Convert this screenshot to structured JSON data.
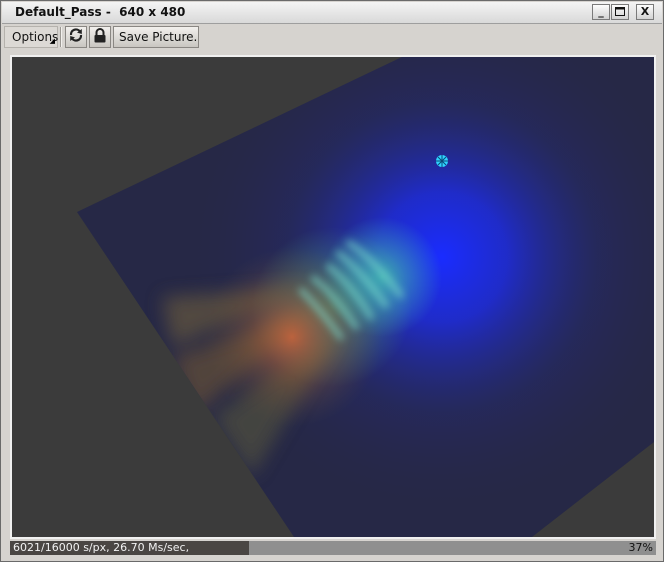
{
  "window": {
    "title": "Default_Pass -  640 x 480",
    "minimize_glyph": "_",
    "maximize_glyph": "□",
    "close_glyph": "X"
  },
  "toolbar": {
    "options_label": "Options",
    "refresh_icon": "refresh-icon",
    "lock_icon": "lock-icon",
    "save_label": "Save Picture."
  },
  "render": {
    "background_color": "#3b3b3b",
    "plane_color": "#262846",
    "light_color": "#1a2cff",
    "caustic_colors": [
      "#3fb3b0",
      "#4fa27a",
      "#c9643a"
    ],
    "light_marker_color": "#2fd3ff"
  },
  "status": {
    "text": "6021/16000 s/px, 26.70 Ms/sec,",
    "percent_label": "37%",
    "progress_fraction": 0.37
  }
}
